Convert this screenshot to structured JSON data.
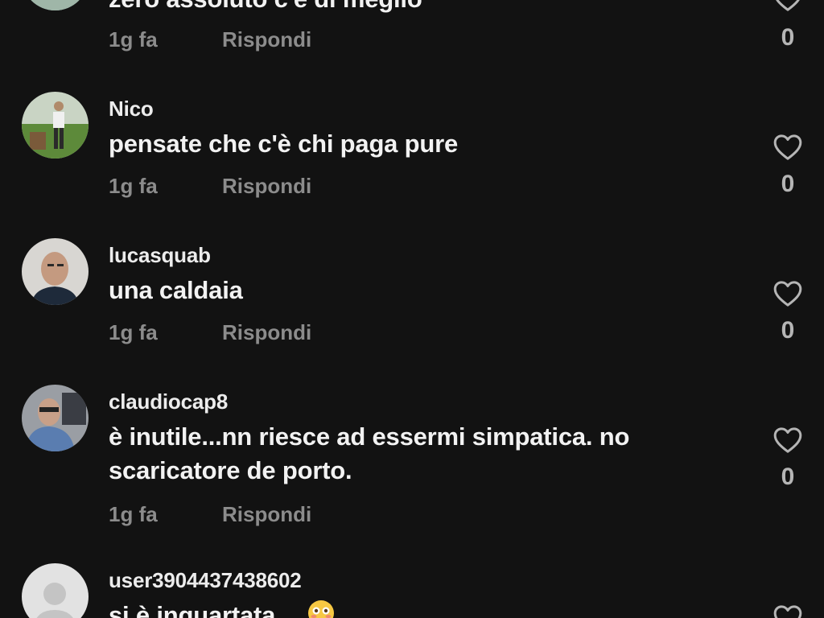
{
  "comments": [
    {
      "username": "",
      "text": "zero assoluto c'è di meglio",
      "time": "1g fa",
      "reply": "Rispondi",
      "likes": "0"
    },
    {
      "username": "Nico",
      "text": "pensate che c'è chi paga pure",
      "time": "1g fa",
      "reply": "Rispondi",
      "likes": "0"
    },
    {
      "username": "lucasquab",
      "text": "una caldaia",
      "time": "1g fa",
      "reply": "Rispondi",
      "likes": "0"
    },
    {
      "username": "claudiocap8",
      "text": "è inutile...nn riesce ad essermi simpatica. no scaricatore de porto.",
      "time": "1g fa",
      "reply": "Rispondi",
      "likes": "0"
    },
    {
      "username": "user3904437438602",
      "text": "si è inquartata....",
      "emoji": "flushed-face",
      "likes": ""
    }
  ],
  "colors": {
    "background": "#121212",
    "primary_text": "#f2f2f2",
    "secondary_text": "#8c8c8c",
    "icon": "#b5b5b5"
  }
}
